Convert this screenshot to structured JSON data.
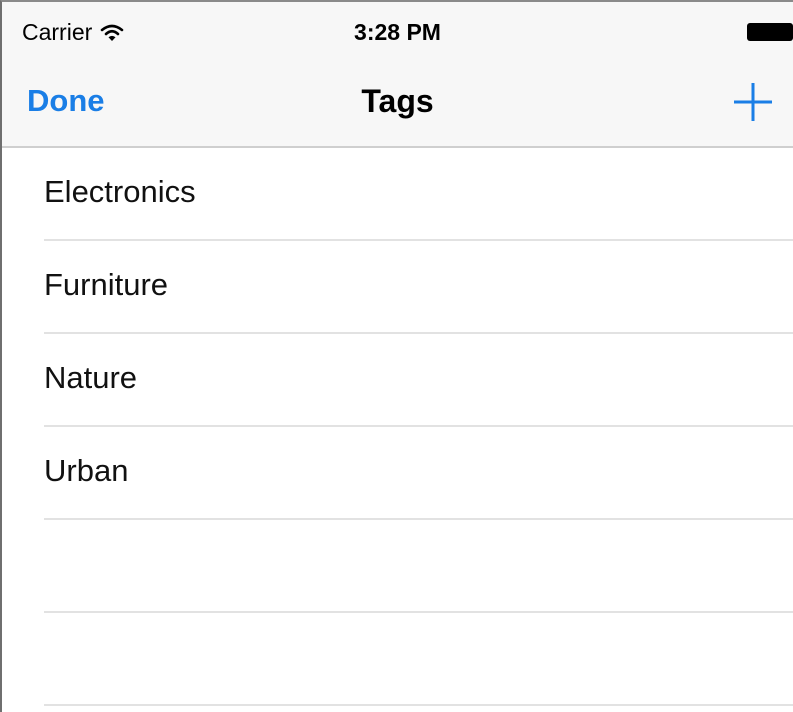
{
  "status_bar": {
    "carrier": "Carrier",
    "time": "3:28 PM"
  },
  "nav_bar": {
    "done_label": "Done",
    "title": "Tags",
    "add_icon": "plus-icon"
  },
  "tags": [
    "Electronics",
    "Furniture",
    "Nature",
    "Urban"
  ],
  "colors": {
    "accent": "#1a7ee6",
    "bar_background": "#f7f7f7",
    "separator": "#e2e2e2"
  }
}
